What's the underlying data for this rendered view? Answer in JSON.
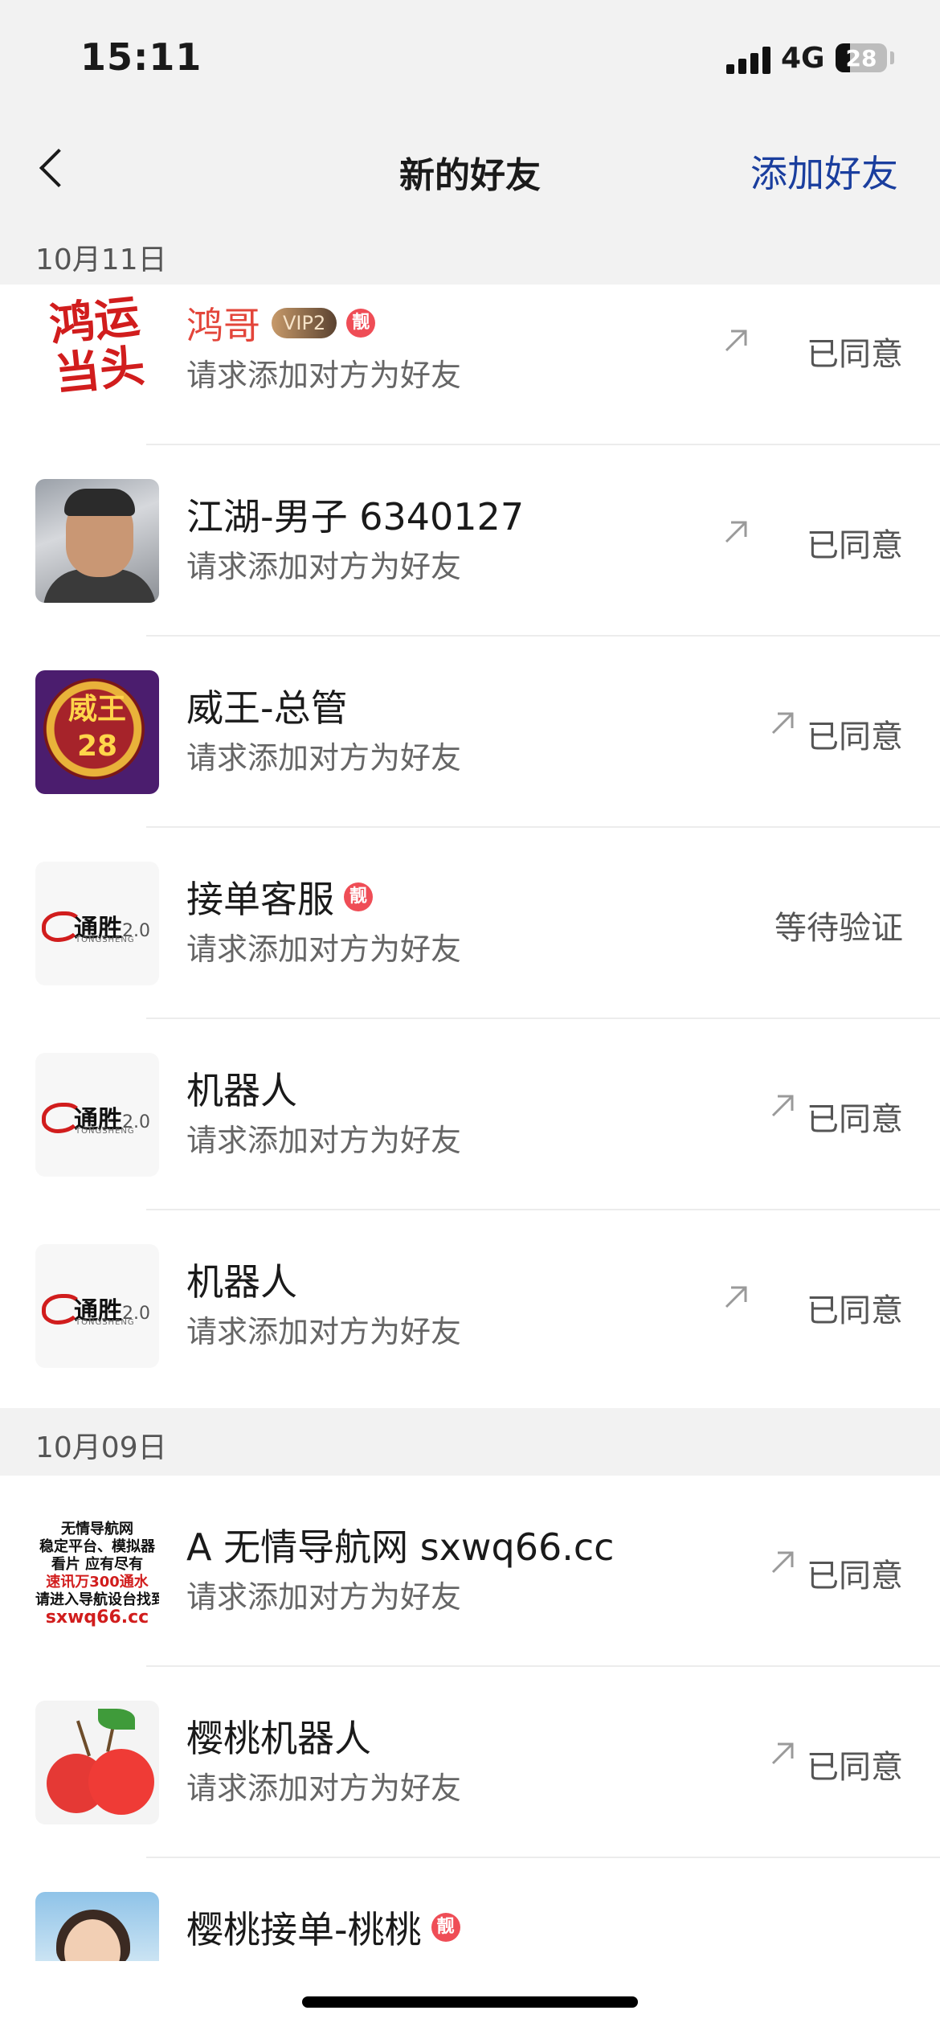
{
  "status_bar": {
    "time": "15:11",
    "network": "4G",
    "battery": "28",
    "battery_level": 0.28
  },
  "nav": {
    "title": "新的好友",
    "action": "添加好友"
  },
  "sections": [
    {
      "date": "10月11日"
    },
    {
      "date": "10月09日"
    }
  ],
  "requests": [
    {
      "name": "鸿哥",
      "name_color": "#e3453a",
      "vip": "VIP2",
      "liang": "靓",
      "subtitle": "请求添加对方为好友",
      "status": "已同意",
      "avatar_text": "鸿运当头"
    },
    {
      "name": "江湖-男子 6340127",
      "subtitle": "请求添加对方为好友",
      "status": "已同意"
    },
    {
      "name": "威王-总管",
      "subtitle": "请求添加对方为好友",
      "status": "已同意",
      "avatar_text_1": "威王",
      "avatar_text_2": "28"
    },
    {
      "name": "接单客服",
      "liang": "靓",
      "subtitle": "请求添加对方为好友",
      "status": "等待验证",
      "avatar_brand": "通胜",
      "avatar_ver": "2.0",
      "avatar_en": "TONGSHENG"
    },
    {
      "name": "机器人",
      "subtitle": "请求添加对方为好友",
      "status": "已同意",
      "avatar_brand": "通胜",
      "avatar_ver": "2.0",
      "avatar_en": "TONGSHENG"
    },
    {
      "name": "机器人",
      "subtitle": "请求添加对方为好友",
      "status": "已同意",
      "avatar_brand": "通胜",
      "avatar_ver": "2.0",
      "avatar_en": "TONGSHENG"
    },
    {
      "name": "A 无情导航网 sxwq66.cc",
      "subtitle": "请求添加对方为好友",
      "status": "已同意",
      "avatar_lines": [
        "无情导航网",
        "稳定平台、模拟器",
        "看片 应有尽有",
        "速讯万300通水",
        "请进入导航设台找到",
        "sxwq66.cc"
      ]
    },
    {
      "name": "樱桃机器人",
      "subtitle": "请求添加对方为好友",
      "status": "已同意"
    },
    {
      "name": "樱桃接单-桃桃",
      "liang": "靓"
    }
  ],
  "icons": {
    "back": "chevron-left-icon",
    "arrow": "arrow-up-right-icon",
    "signal": "signal-bars-icon",
    "battery": "battery-icon"
  }
}
